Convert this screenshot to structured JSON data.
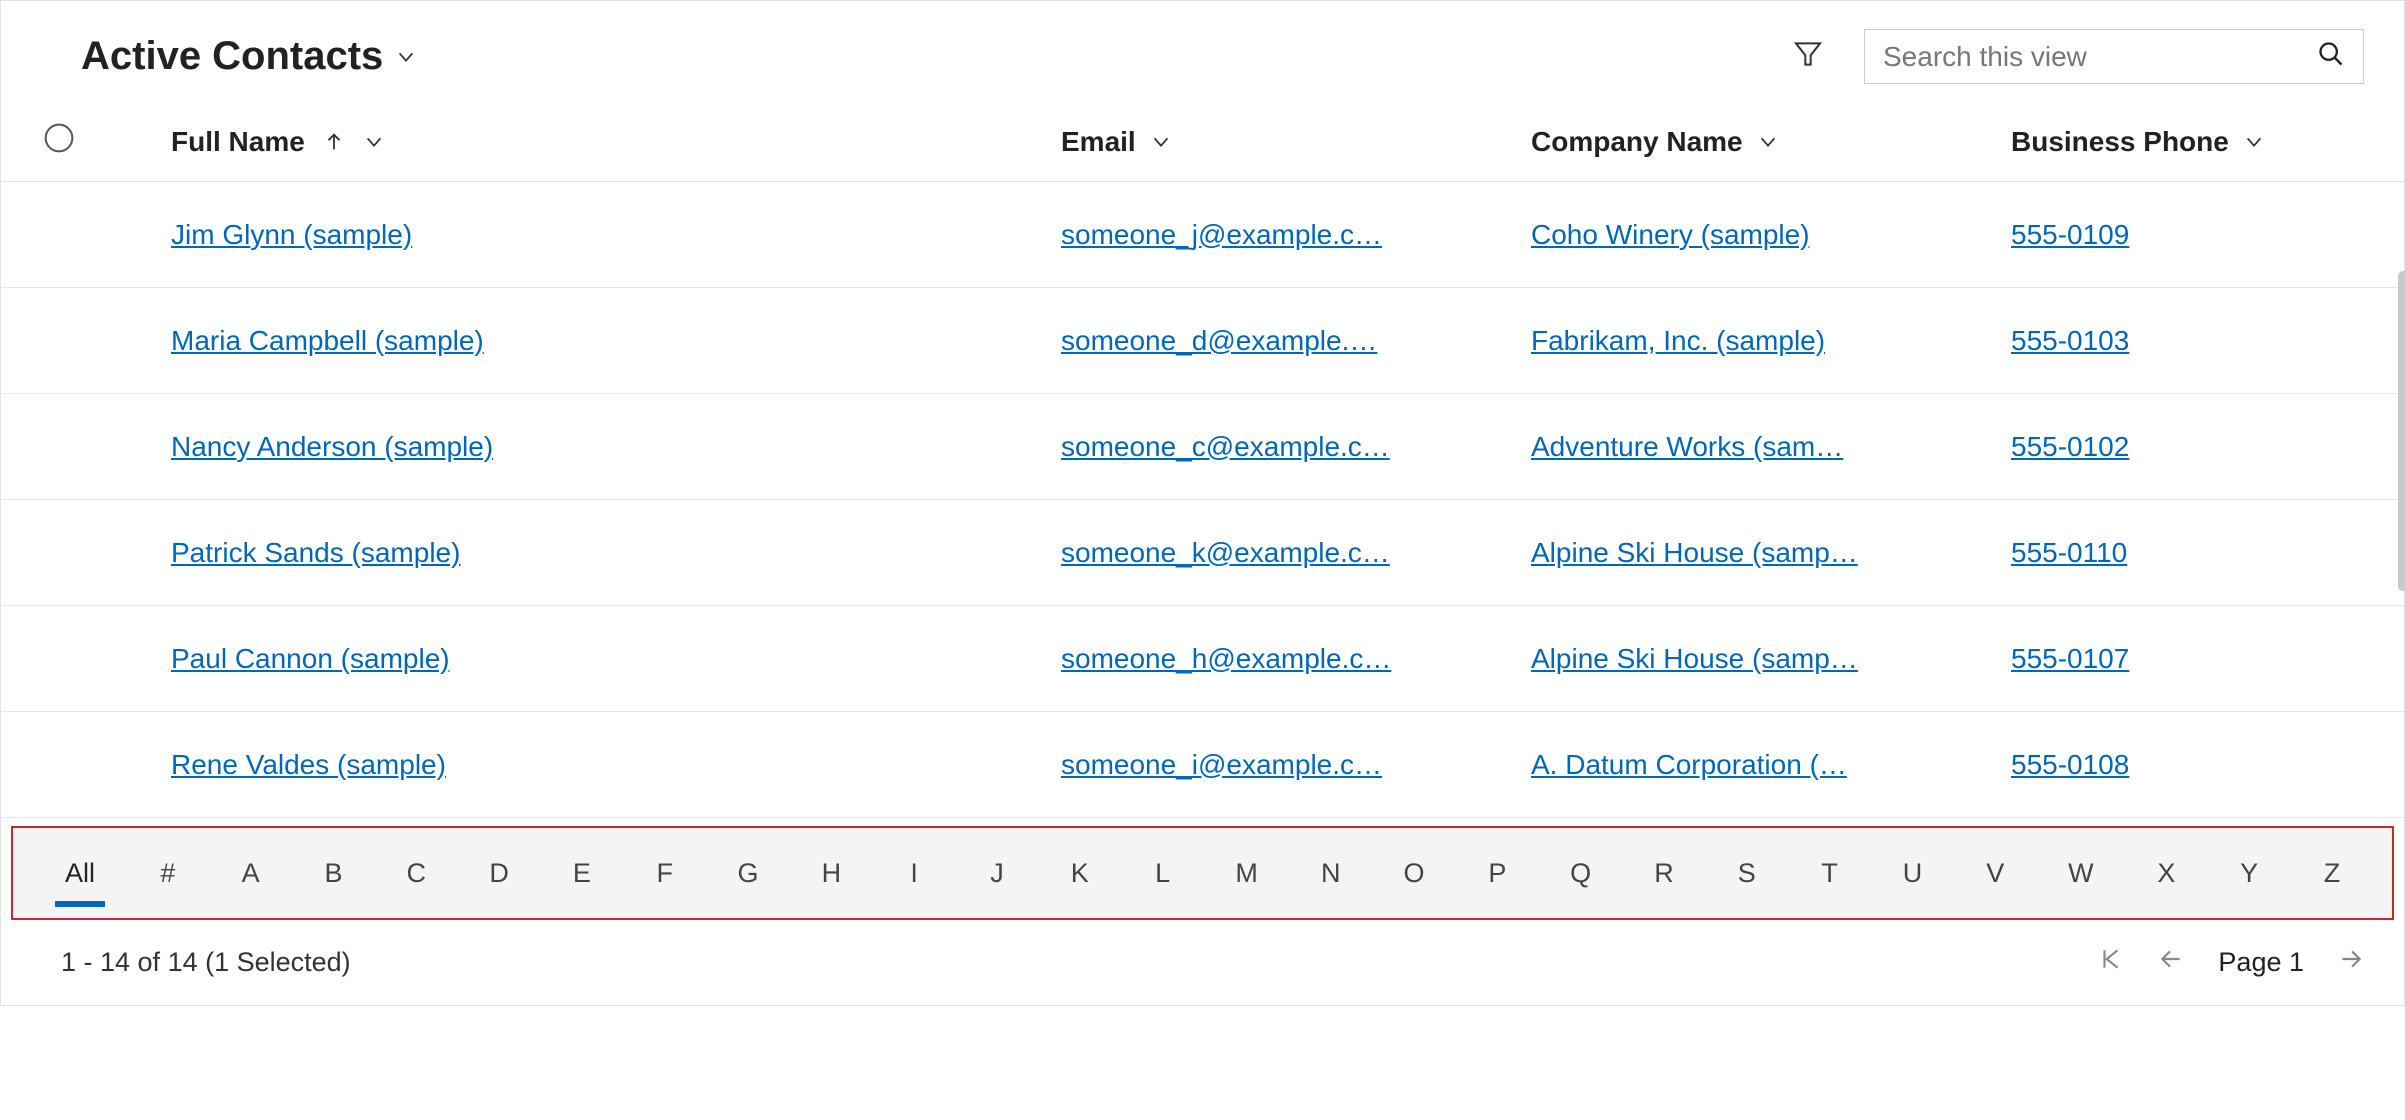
{
  "header": {
    "view_title": "Active Contacts",
    "search_placeholder": "Search this view"
  },
  "columns": {
    "fullname": "Full Name",
    "email": "Email",
    "company": "Company Name",
    "phone": "Business Phone"
  },
  "rows": [
    {
      "name": "Jim Glynn (sample)",
      "email": "someone_j@example.c…",
      "company": "Coho Winery (sample)",
      "phone": "555-0109"
    },
    {
      "name": "Maria Campbell (sample)",
      "email": "someone_d@example.…",
      "company": "Fabrikam, Inc. (sample)",
      "phone": "555-0103"
    },
    {
      "name": "Nancy Anderson (sample)",
      "email": "someone_c@example.c…",
      "company": "Adventure Works (sam…",
      "phone": "555-0102"
    },
    {
      "name": "Patrick Sands (sample)",
      "email": "someone_k@example.c…",
      "company": "Alpine Ski House (samp…",
      "phone": "555-0110"
    },
    {
      "name": "Paul Cannon (sample)",
      "email": "someone_h@example.c…",
      "company": "Alpine Ski House (samp…",
      "phone": "555-0107"
    },
    {
      "name": "Rene Valdes (sample)",
      "email": "someone_i@example.c…",
      "company": "A. Datum Corporation (…",
      "phone": "555-0108"
    }
  ],
  "alpha_bar": [
    "All",
    "#",
    "A",
    "B",
    "C",
    "D",
    "E",
    "F",
    "G",
    "H",
    "I",
    "J",
    "K",
    "L",
    "M",
    "N",
    "O",
    "P",
    "Q",
    "R",
    "S",
    "T",
    "U",
    "V",
    "W",
    "X",
    "Y",
    "Z"
  ],
  "alpha_active": "All",
  "footer": {
    "status": "1 - 14 of 14 (1 Selected)",
    "page_label": "Page 1"
  }
}
